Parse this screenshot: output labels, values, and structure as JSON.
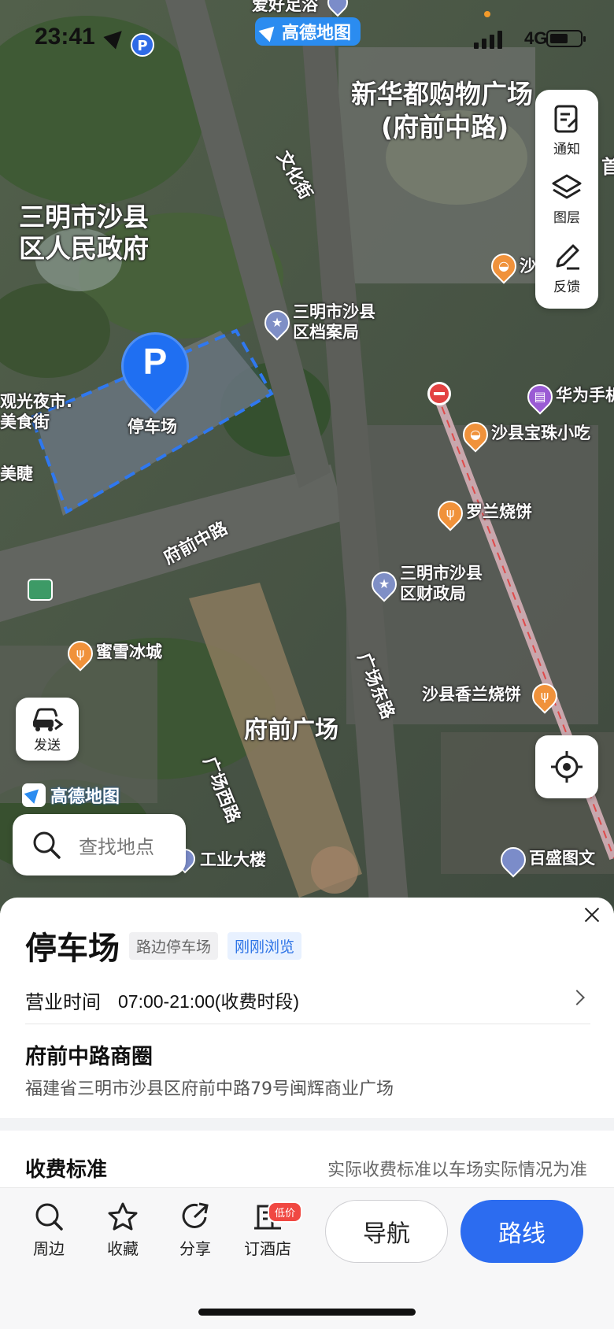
{
  "status_bar": {
    "time": "23:41",
    "network": "4G"
  },
  "brand": {
    "top": "高德地图",
    "bottom": "高德地图"
  },
  "map_labels": {
    "top_partial": "爱好足浴",
    "mall": "新华都购物广场",
    "mall_sub": "(府前中路)",
    "gov_line1": "三明市沙县",
    "gov_line2": "区人民政府",
    "wenhua": "文化街",
    "archive_line1": "三明市沙县",
    "archive_line2": "区档案局",
    "night_market_1": "观光夜市.",
    "night_market_2": "美食街",
    "meijie": "美睫",
    "parking": "停车场",
    "fuqian_road": "府前中路",
    "huawei": "华为手机",
    "baozhu": "沙县宝珠小吃",
    "luolan": "罗兰烧饼",
    "finance_line1": "三明市沙县",
    "finance_line2": "区财政局",
    "mixue": "蜜雪冰城",
    "guangchang_east": "广场东路",
    "xianglan": "沙县香兰烧饼",
    "fuqian_plaza": "府前广场",
    "guangchang_west": "广场西路",
    "gongye": "工业大楼",
    "baisheng": "百盛图文",
    "sha_partial": "沙",
    "shou_partial": "首"
  },
  "tools": {
    "notify": "通知",
    "layers": "图层",
    "feedback": "反馈",
    "send": "发送"
  },
  "search": {
    "placeholder": "查找地点"
  },
  "place": {
    "title": "停车场",
    "tag_type": "路边停车场",
    "tag_recent": "刚刚浏览",
    "hours_label": "营业时间",
    "hours_value": "07:00-21:00(收费时段)",
    "area_title": "府前中路商圈",
    "address": "福建省三明市沙县区府前中路79号闽辉商业广场",
    "fee_title": "收费标准",
    "fee_note": "实际收费标准以车场实际情况为准"
  },
  "actions": {
    "nearby": "周边",
    "favorite": "收藏",
    "share": "分享",
    "hotel": "订酒店",
    "hotel_badge": "低价",
    "navigate": "导航",
    "route": "路线"
  },
  "colors": {
    "accent": "#2c6cf0",
    "parking_pin": "#1f6ff2",
    "badge": "#f04842"
  }
}
